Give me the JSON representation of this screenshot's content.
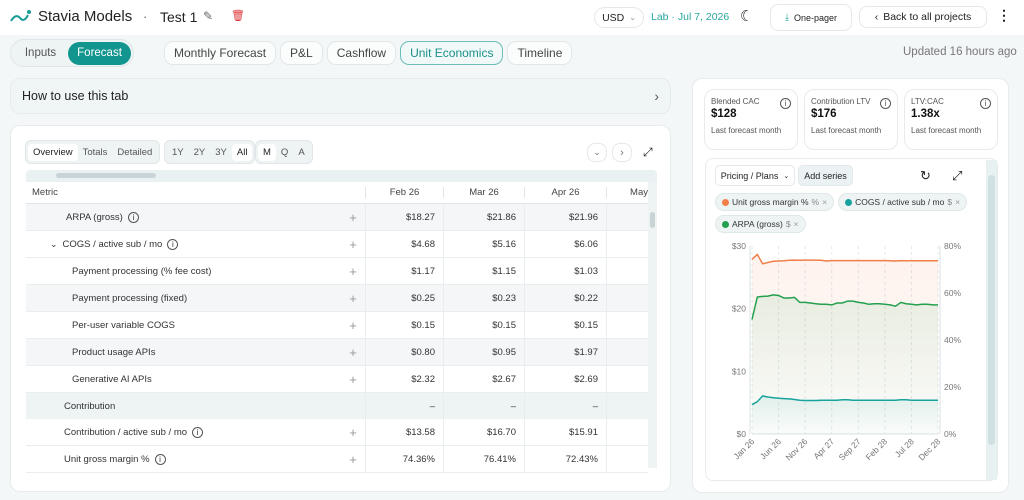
{
  "header": {
    "app": "Stavia Models",
    "separator": "·",
    "project": "Test 1",
    "currency": "USD",
    "lab": "Lab · Jul 7, 2026",
    "one_pager": "One-pager",
    "back": "Back to all projects"
  },
  "nav": {
    "modes": [
      "Inputs",
      "Forecast"
    ],
    "tabs": [
      "Monthly Forecast",
      "P&L",
      "Cashflow",
      "Unit Economics",
      "Timeline"
    ],
    "updated": "Updated 16 hours ago"
  },
  "howto": "How to use this tab",
  "table": {
    "views": [
      "Overview",
      "Totals",
      "Detailed"
    ],
    "ranges": [
      "1Y",
      "2Y",
      "3Y",
      "All"
    ],
    "periods": [
      "M",
      "Q",
      "A"
    ],
    "header": [
      "Metric",
      "Feb 26",
      "Mar 26",
      "Apr 26",
      "May"
    ],
    "rows": [
      {
        "label": "ARPA (gross)",
        "values": [
          "$18.27",
          "$21.86",
          "$21.96"
        ]
      },
      {
        "label": "COGS / active sub / mo",
        "values": [
          "$4.68",
          "$5.16",
          "$6.06"
        ]
      },
      {
        "label": "Payment processing (% fee cost)",
        "values": [
          "$1.17",
          "$1.15",
          "$1.03"
        ]
      },
      {
        "label": "Payment processing (fixed)",
        "values": [
          "$0.25",
          "$0.23",
          "$0.22"
        ]
      },
      {
        "label": "Per-user variable COGS",
        "values": [
          "$0.15",
          "$0.15",
          "$0.15"
        ]
      },
      {
        "label": "Product usage APIs",
        "values": [
          "$0.80",
          "$0.95",
          "$1.97"
        ]
      },
      {
        "label": "Generative AI APIs",
        "values": [
          "$2.32",
          "$2.67",
          "$2.69"
        ]
      },
      {
        "label": "Contribution",
        "values": [
          "–",
          "–",
          "–"
        ]
      },
      {
        "label": "Contribution / active sub / mo",
        "values": [
          "$13.58",
          "$16.70",
          "$15.91"
        ]
      },
      {
        "label": "Unit gross margin %",
        "values": [
          "74.36%",
          "76.41%",
          "72.43%"
        ]
      }
    ]
  },
  "kpis": [
    {
      "label": "Blended CAC",
      "value": "$128",
      "sub": "Last forecast month"
    },
    {
      "label": "Contribution LTV",
      "value": "$176",
      "sub": "Last forecast month"
    },
    {
      "label": "LTV:CAC",
      "value": "1.38x",
      "sub": "Last forecast month"
    }
  ],
  "chart_controls": {
    "dropdown": "Pricing / Plans",
    "add": "Add series"
  },
  "chart_data": {
    "type": "line",
    "x_ticks": [
      "Jan 26",
      "Jun 26",
      "Nov 26",
      "Apr 27",
      "Sep 27",
      "Feb 28",
      "Jul 28",
      "Dec 28"
    ],
    "y_left": {
      "ticks": [
        "$0",
        "$10",
        "$20",
        "$30"
      ],
      "range": [
        0,
        30
      ]
    },
    "y_right": {
      "ticks": [
        "0%",
        "20%",
        "40%",
        "60%",
        "80%"
      ],
      "range": [
        0,
        80
      ]
    },
    "series": [
      {
        "name": "Unit gross margin %",
        "unit": "%",
        "axis": "right",
        "color": "#f07f4a",
        "values": [
          74.36,
          76.41,
          72.43,
          73.0,
          73.5,
          73.6,
          73.7,
          73.9,
          74.0,
          73.9,
          74.0,
          74.0,
          74.0,
          73.9,
          73.6,
          73.8,
          73.8,
          73.8,
          73.8,
          73.8,
          73.8,
          73.8,
          73.8,
          73.8,
          73.8,
          73.8,
          73.7,
          73.6,
          73.8,
          73.7,
          73.7,
          73.7,
          73.7,
          73.7,
          73.7,
          73.7
        ]
      },
      {
        "name": "COGS / active sub / mo",
        "unit": "$",
        "axis": "left",
        "color": "#17a2a0",
        "values": [
          4.68,
          5.16,
          6.06,
          5.9,
          5.8,
          5.7,
          5.65,
          5.6,
          5.5,
          5.4,
          5.35,
          5.35,
          5.35,
          5.4,
          5.4,
          5.4,
          5.4,
          5.45,
          5.45,
          5.4,
          5.4,
          5.4,
          5.4,
          5.4,
          5.4,
          5.4,
          5.4,
          5.4,
          5.45,
          5.45,
          5.4,
          5.4,
          5.4,
          5.4,
          5.4,
          5.4
        ]
      },
      {
        "name": "ARPA (gross)",
        "unit": "$",
        "axis": "left",
        "color": "#23a04e",
        "values": [
          18.27,
          21.86,
          21.96,
          22.0,
          22.2,
          22.1,
          21.7,
          21.7,
          21.8,
          21.0,
          21.0,
          20.9,
          20.8,
          20.7,
          20.7,
          20.6,
          20.9,
          20.9,
          21.2,
          21.2,
          21.0,
          20.9,
          20.7,
          20.8,
          20.8,
          20.7,
          20.6,
          20.4,
          21.0,
          20.8,
          20.7,
          20.6,
          20.7,
          20.7,
          20.6,
          20.6
        ]
      }
    ]
  }
}
